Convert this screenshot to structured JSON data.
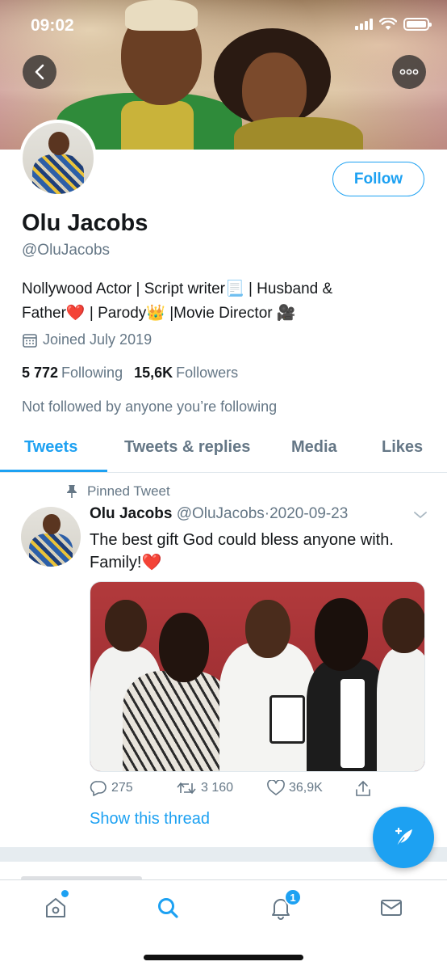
{
  "status_bar": {
    "time": "09:02"
  },
  "profile": {
    "name": "Olu Jacobs",
    "handle": "@OluJacobs",
    "follow_label": "Follow",
    "bio_line1": "Nollywood Actor | Script writer📃 | Husband &",
    "bio_line2": "Father❤️  | Parody👑  |Movie Director 🎥",
    "joined": "Joined July 2019",
    "following_count": "5 772",
    "following_label": "Following",
    "followers_count": "15,6K",
    "followers_label": "Followers",
    "not_followed": "Not followed by anyone you’re following"
  },
  "tabs": [
    {
      "label": "Tweets",
      "active": true
    },
    {
      "label": "Tweets & replies",
      "active": false
    },
    {
      "label": "Media",
      "active": false
    },
    {
      "label": "Likes",
      "active": false
    }
  ],
  "tweet": {
    "pinned_label": "Pinned Tweet",
    "author": "Olu Jacobs",
    "handle": "@OluJacobs",
    "separator": "·",
    "date": "2020-09-23",
    "text_line1": "The best gift God could bless anyone with.",
    "text_line2": "Family!❤️",
    "replies": "275",
    "retweets": "3 160",
    "likes": "36,9K",
    "show_thread": "Show this thread"
  },
  "bottom_nav": {
    "items": [
      "home-icon",
      "search-icon",
      "notifications-icon",
      "messages-icon"
    ],
    "notification_count": "1"
  },
  "colors": {
    "accent": "#1da1f2",
    "text_primary": "#14171a",
    "text_secondary": "#657786",
    "heart": "#e0245e"
  }
}
